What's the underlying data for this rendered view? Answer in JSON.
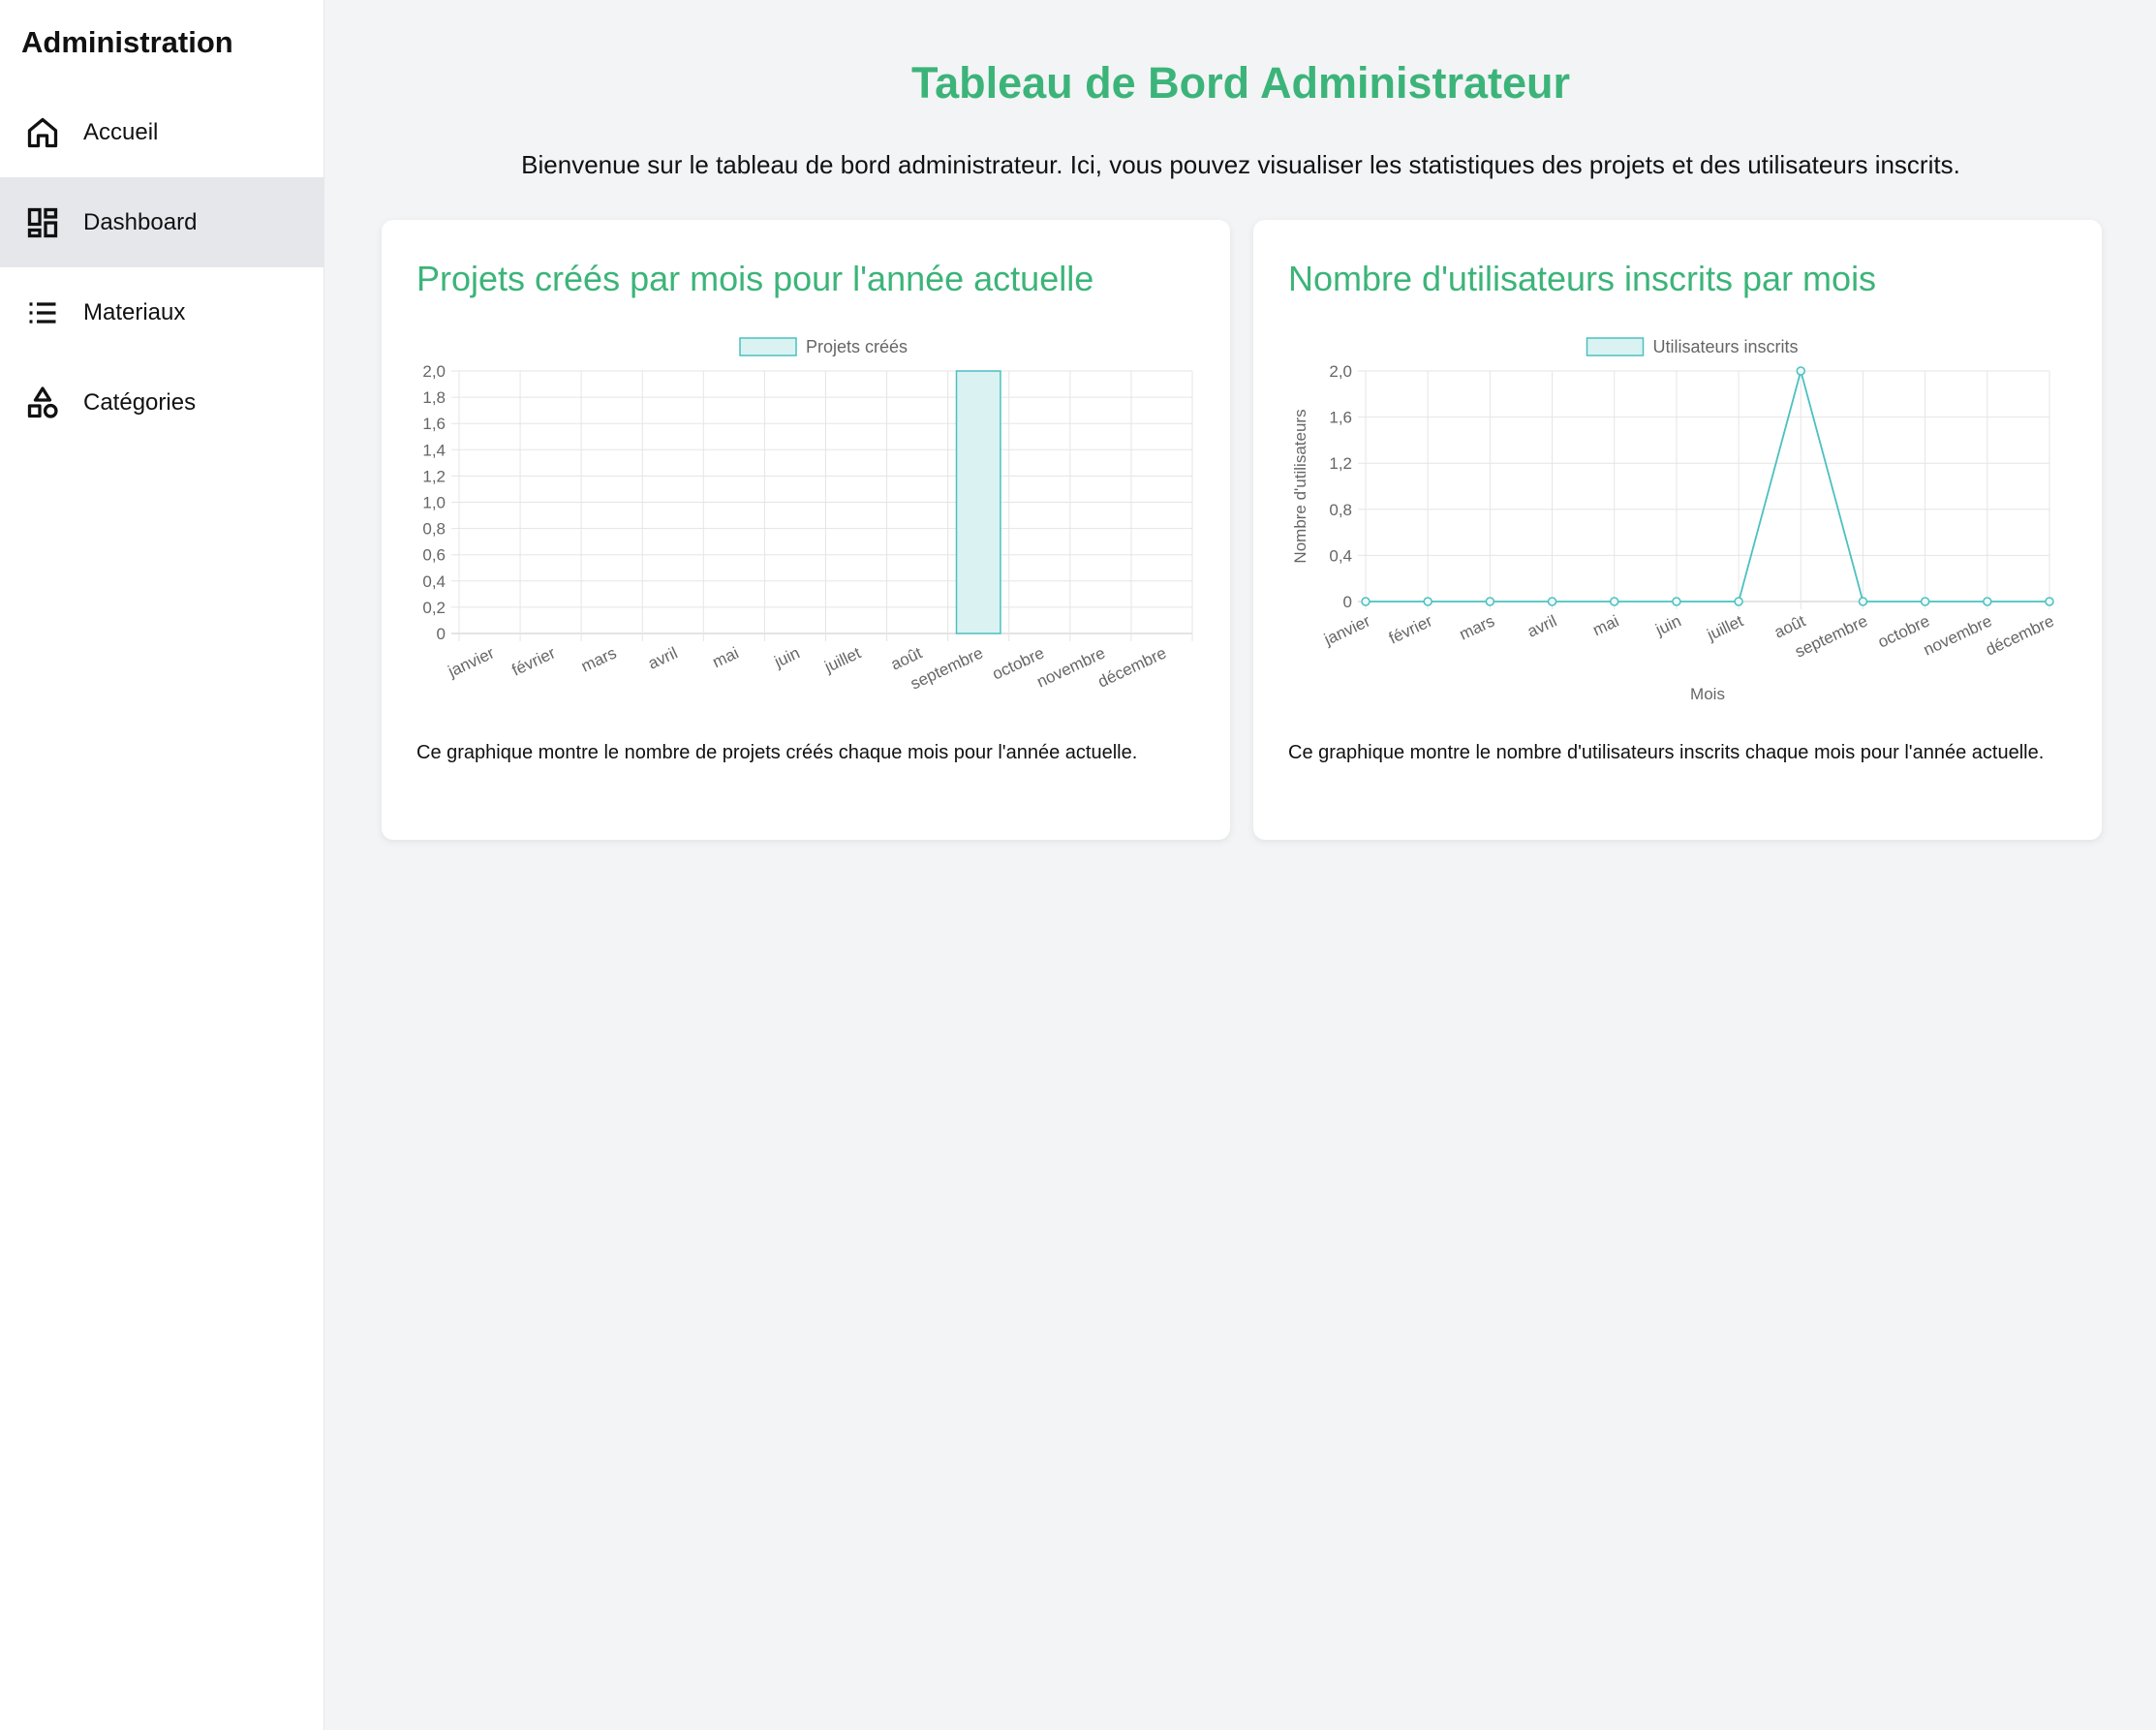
{
  "sidebar": {
    "title": "Administration",
    "items": [
      {
        "label": "Accueil",
        "icon": "home-icon",
        "active": false
      },
      {
        "label": "Dashboard",
        "icon": "dashboard-icon",
        "active": true
      },
      {
        "label": "Materiaux",
        "icon": "list-icon",
        "active": false
      },
      {
        "label": "Catégories",
        "icon": "shapes-icon",
        "active": false
      }
    ]
  },
  "main": {
    "title": "Tableau de Bord Administrateur",
    "intro": "Bienvenue sur le tableau de bord administrateur. Ici, vous pouvez visualiser les statistiques des projets et des utilisateurs inscrits."
  },
  "colors": {
    "accent": "#3cb479",
    "series": "#4bc0c0",
    "series_fill": "#dbf2f2"
  },
  "cards": [
    {
      "title": "Projets créés par mois pour l'année actuelle",
      "description": "Ce graphique montre le nombre de projets créés chaque mois pour l'année actuelle."
    },
    {
      "title": "Nombre d'utilisateurs inscrits par mois",
      "description": "Ce graphique montre le nombre d'utilisateurs inscrits chaque mois pour l'année actuelle."
    }
  ],
  "chart_data": [
    {
      "type": "bar",
      "categories": [
        "janvier",
        "février",
        "mars",
        "avril",
        "mai",
        "juin",
        "juillet",
        "août",
        "septembre",
        "octobre",
        "novembre",
        "décembre"
      ],
      "series": [
        {
          "name": "Projets créés",
          "values": [
            0,
            0,
            0,
            0,
            0,
            0,
            0,
            0,
            2,
            0,
            0,
            0
          ]
        }
      ],
      "ylim": [
        0,
        2
      ],
      "yticks": [
        "0",
        "0,2",
        "0,4",
        "0,6",
        "0,8",
        "1,0",
        "1,2",
        "1,4",
        "1,6",
        "1,8",
        "2,0"
      ],
      "xlabel": "",
      "ylabel": "",
      "legend": "top",
      "grid": true
    },
    {
      "type": "line",
      "categories": [
        "janvier",
        "février",
        "mars",
        "avril",
        "mai",
        "juin",
        "juillet",
        "août",
        "septembre",
        "octobre",
        "novembre",
        "décembre"
      ],
      "series": [
        {
          "name": "Utilisateurs inscrits",
          "values": [
            0,
            0,
            0,
            0,
            0,
            0,
            0,
            2,
            0,
            0,
            0,
            0
          ]
        }
      ],
      "ylim": [
        0,
        2
      ],
      "yticks": [
        "0",
        "0,4",
        "0,8",
        "1,2",
        "1,6",
        "2,0"
      ],
      "xlabel": "Mois",
      "ylabel": "Nombre d'utilisateurs",
      "legend": "top",
      "grid": true
    }
  ]
}
